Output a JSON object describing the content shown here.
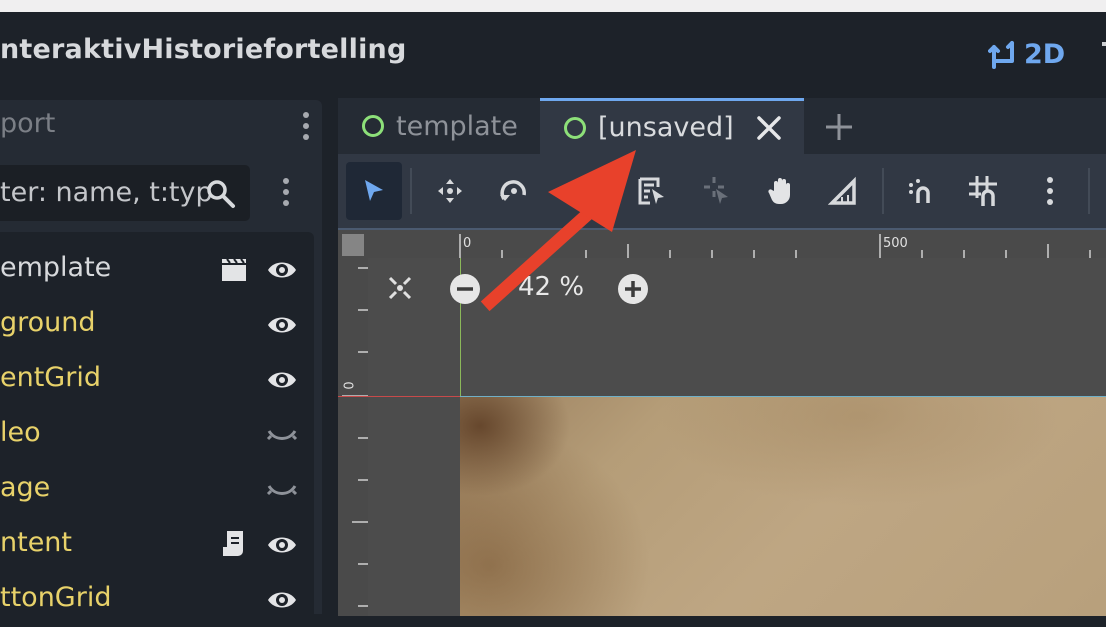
{
  "window": {
    "project_title": "nteraktivHistoriefortelling",
    "view_mode_label": "2D"
  },
  "scene_panel": {
    "tab_label": "port",
    "filter_placeholder": "ter: name, t:typ",
    "nodes": [
      {
        "label": "emplate",
        "color": "#d7d9dc",
        "icon": "clapperboard-icon",
        "visible": true
      },
      {
        "label": "ground",
        "color": "#e8d26a",
        "icon": null,
        "visible": true
      },
      {
        "label": "entGrid",
        "color": "#e8d26a",
        "icon": null,
        "visible": true
      },
      {
        "label": "leo",
        "color": "#e8d26a",
        "icon": null,
        "visible": false
      },
      {
        "label": "age",
        "color": "#e8d26a",
        "icon": null,
        "visible": false
      },
      {
        "label": "ntent",
        "color": "#e8d26a",
        "icon": "script-icon",
        "visible": true
      },
      {
        "label": "ttonGrid",
        "color": "#e8d26a",
        "icon": null,
        "visible": true
      }
    ]
  },
  "editor": {
    "tabs": [
      {
        "label": "template",
        "active": false
      },
      {
        "label": "[unsaved]",
        "active": true
      }
    ],
    "toolbar_tools": [
      "select-tool-icon",
      "move-tool-icon",
      "rotate-tool-icon",
      "scale-tool-icon",
      "list-select-icon",
      "pivot-tool-icon",
      "pan-tool-icon",
      "ruler-tool-icon",
      "smart-snap-icon",
      "grid-snap-icon",
      "more-options-icon"
    ],
    "ruler_top_labels": [
      "0",
      "500"
    ],
    "ruler_left_labels": [
      "0"
    ],
    "zoom_level": "42 %"
  },
  "colors": {
    "accent": "#6fa8ef",
    "scene_circle": "#8de079",
    "annotation_arrow": "#e8412b"
  }
}
